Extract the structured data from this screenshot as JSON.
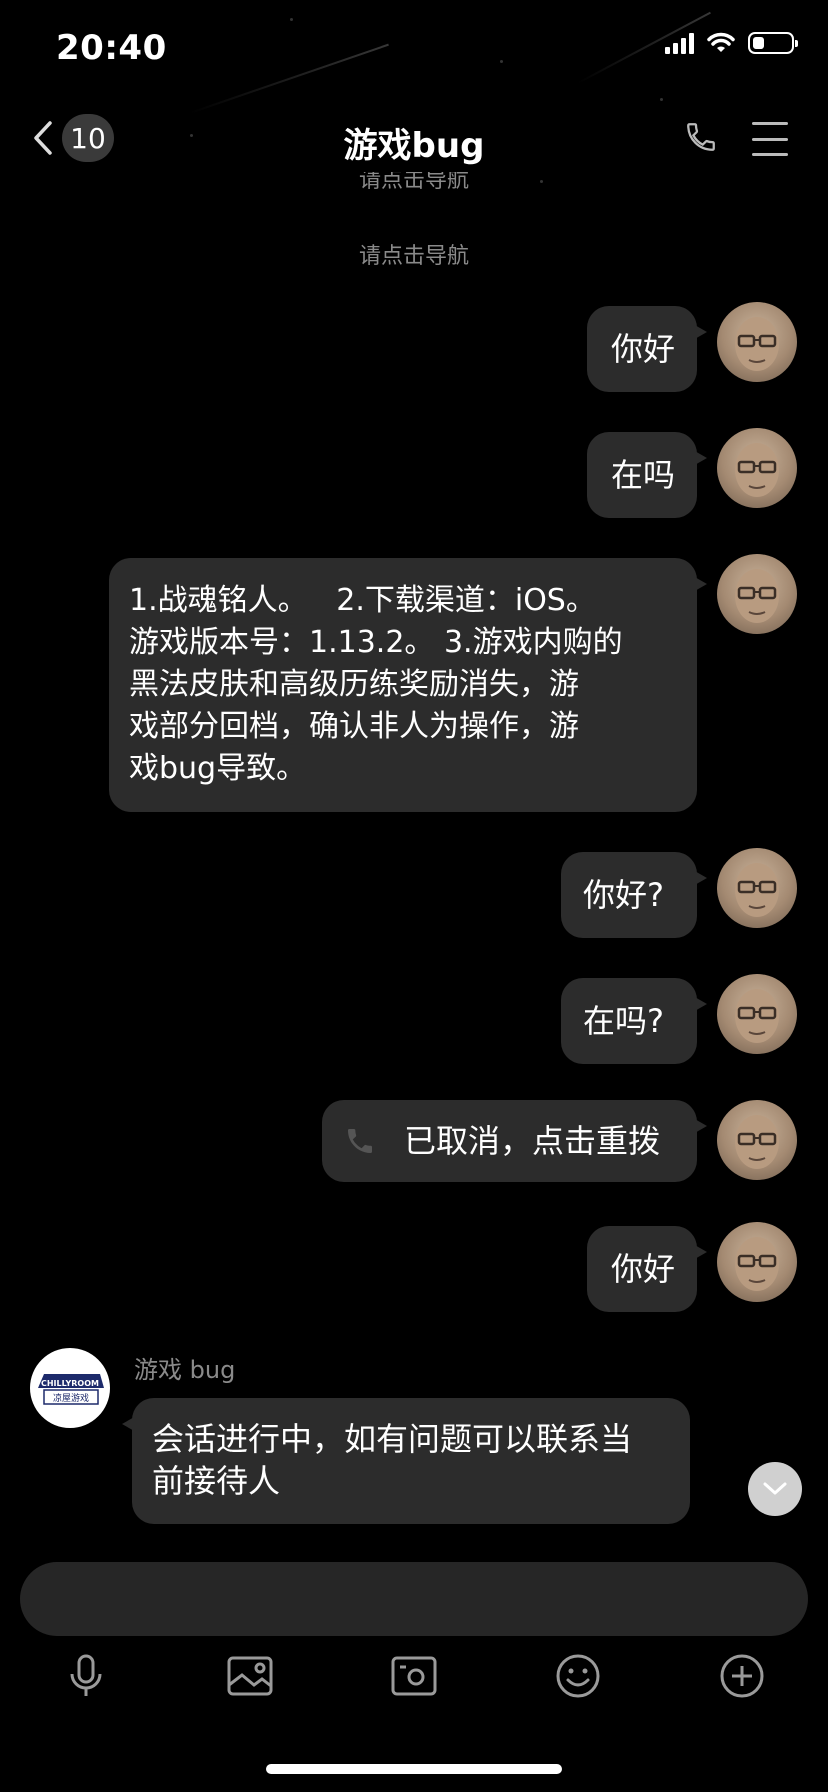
{
  "status_bar": {
    "time": "20:40",
    "battery_level": 0.3
  },
  "header": {
    "title": "游戏bug",
    "unread_count": "10",
    "back_icon": "chevron-left-icon",
    "call_icon": "phone-icon",
    "menu_icon": "hamburger-menu-icon"
  },
  "system_notes": [
    "请点击导航",
    "请点击导航"
  ],
  "messages": [
    {
      "direction": "out",
      "text": "你好"
    },
    {
      "direction": "out",
      "text": "在吗"
    },
    {
      "direction": "out",
      "text": "1.战魂铭人。   2.下载渠道：iOS。\n游戏版本号：1.13.2。 3.游戏内购的\n黑法皮肤和高级历练奖励消失，游\n戏部分回档，确认非人为操作，游\n戏bug导致。"
    },
    {
      "direction": "out",
      "text": "你好?"
    },
    {
      "direction": "out",
      "text": "在吗?"
    },
    {
      "direction": "out",
      "type": "call",
      "text": "已取消，点击重拨",
      "icon": "phone-icon"
    },
    {
      "direction": "out",
      "text": "你好"
    },
    {
      "direction": "in",
      "sender": "游戏 bug",
      "text": "会话进行中，如有问题可以联系当\n前接待人"
    }
  ],
  "logo": {
    "line1": "CHILLYROOM",
    "line2": "凉屋游戏"
  },
  "input": {
    "placeholder": "",
    "value": ""
  },
  "toolbar": {
    "icons": [
      "microphone-icon",
      "image-icon",
      "camera-icon",
      "emoji-icon",
      "plus-icon"
    ]
  },
  "colors": {
    "background": "#000000",
    "bubble": "#2c2c2c",
    "input": "#262626",
    "secondary_text": "#8a8a8a"
  }
}
